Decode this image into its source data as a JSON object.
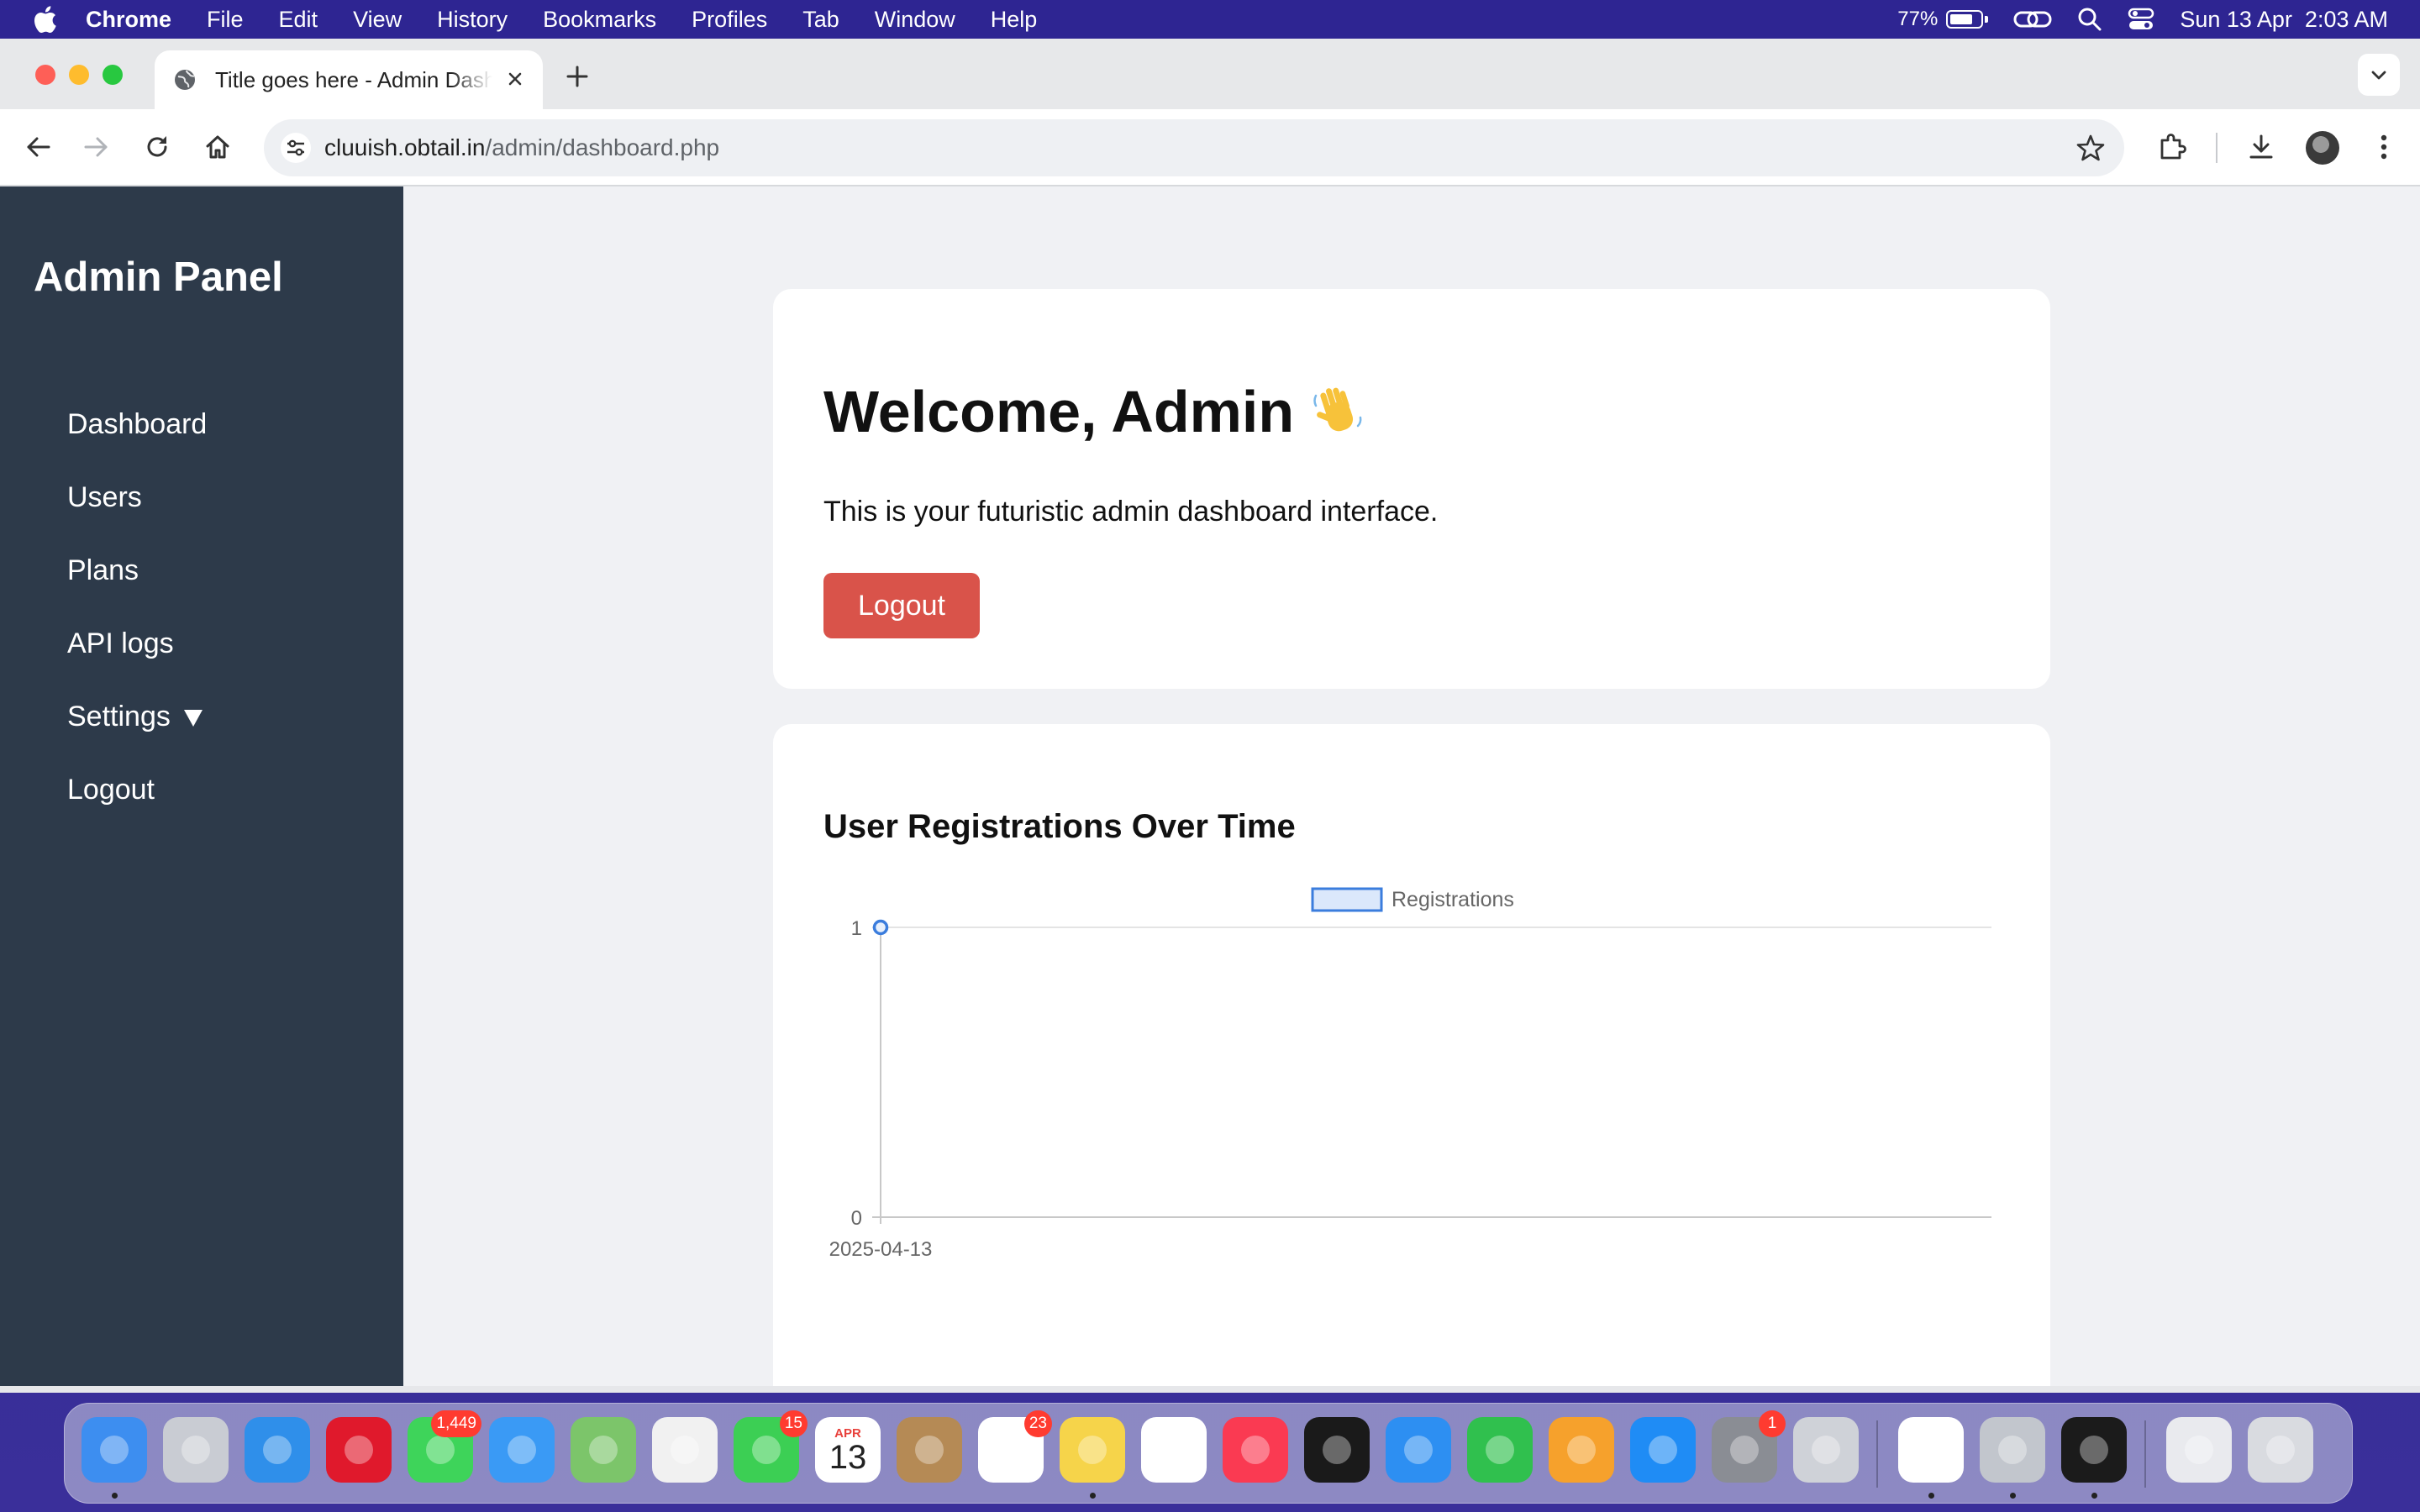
{
  "menubar": {
    "items": [
      "Chrome",
      "File",
      "Edit",
      "View",
      "History",
      "Bookmarks",
      "Profiles",
      "Tab",
      "Window",
      "Help"
    ],
    "battery_percent": "77%",
    "battery_level": 0.77,
    "datetime": "Sun 13 Apr  2:03 AM"
  },
  "browser": {
    "tab_title": "Title goes here - Admin Dashboard",
    "url_host": "cluuish.obtail.in",
    "url_path": "/admin/dashboard.php"
  },
  "sidebar": {
    "brand": "Admin Panel",
    "items": [
      {
        "label": "Dashboard"
      },
      {
        "label": "Users"
      },
      {
        "label": "Plans"
      },
      {
        "label": "API logs"
      },
      {
        "label": "Settings"
      },
      {
        "label": "Logout"
      }
    ]
  },
  "welcome_card": {
    "heading": "Welcome, Admin",
    "subtitle": "This is your futuristic admin dashboard interface.",
    "logout_label": "Logout"
  },
  "chart_card": {
    "title": "User Registrations Over Time"
  },
  "chart_data": {
    "type": "line",
    "title": "User Registrations Over Time",
    "x": [
      "2025-04-13"
    ],
    "series": [
      {
        "name": "Registrations",
        "values": [
          1
        ],
        "color": "#3b7ddd"
      }
    ],
    "ylim": [
      0,
      1
    ],
    "yticks": [
      "1",
      "0"
    ],
    "xlabel": "",
    "ylabel": "",
    "grid": true,
    "legend": "top-center"
  },
  "dock": {
    "apps": [
      {
        "name": "Finder",
        "icon": "finder-icon",
        "color": "#3d8ef0",
        "dot": true
      },
      {
        "name": "Launchpad",
        "icon": "launchpad-icon",
        "color": "#c9ccd3"
      },
      {
        "name": "Safari",
        "icon": "safari-icon",
        "color": "#2f8fea"
      },
      {
        "name": "Opera",
        "icon": "opera-icon",
        "color": "#e0192c"
      },
      {
        "name": "Messages",
        "icon": "messages-icon",
        "color": "#3ed45a",
        "badge": "1,449"
      },
      {
        "name": "Mail",
        "icon": "mail-icon",
        "color": "#3a9af5"
      },
      {
        "name": "Maps",
        "icon": "maps-icon",
        "color": "#7cc56a"
      },
      {
        "name": "Photos",
        "icon": "photos-icon",
        "color": "#f1f1f1"
      },
      {
        "name": "FaceTime",
        "icon": "facetime-icon",
        "color": "#3ccf54",
        "badge": "15"
      },
      {
        "name": "Calendar",
        "icon": "calendar-icon",
        "color": "#ffffff",
        "calendar_month": "APR",
        "calendar_day": "13"
      },
      {
        "name": "Contacts",
        "icon": "contacts-icon",
        "color": "#b58a55"
      },
      {
        "name": "Reminders",
        "icon": "reminders-icon",
        "color": "#ffffff",
        "badge": "23"
      },
      {
        "name": "Notes",
        "icon": "notes-icon",
        "color": "#f6d44a",
        "dot": true
      },
      {
        "name": "Freeform",
        "icon": "freeform-icon",
        "color": "#ffffff"
      },
      {
        "name": "Music",
        "icon": "music-icon",
        "color": "#fa3a52"
      },
      {
        "name": "TV",
        "icon": "tv-icon",
        "color": "#1a1a1a"
      },
      {
        "name": "Keynote",
        "icon": "keynote-icon",
        "color": "#2d8ff2"
      },
      {
        "name": "Numbers",
        "icon": "numbers-icon",
        "color": "#30c04e"
      },
      {
        "name": "Pages",
        "icon": "pages-icon",
        "color": "#f6a12c"
      },
      {
        "name": "App Store",
        "icon": "app-store-icon",
        "color": "#1f8cf5"
      },
      {
        "name": "System Settings",
        "icon": "system-settings-icon",
        "color": "#8a8d94",
        "badge": "1"
      },
      {
        "name": "iPhone Mirroring",
        "icon": "iphone-mirroring-icon",
        "color": "#cfd2d8"
      },
      {
        "name": "Chrome",
        "icon": "chrome-icon",
        "color": "#ffffff",
        "dot": true
      },
      {
        "name": "Preferences",
        "icon": "gear-icon",
        "color": "#c2c6cd",
        "dot": true
      },
      {
        "name": "Terminal",
        "icon": "terminal-icon",
        "color": "#1b1b1b",
        "dot": true
      },
      {
        "name": "Screenshot Preview",
        "icon": "window-thumbnail-icon",
        "color": "#e9eaee"
      },
      {
        "name": "Trash",
        "icon": "trash-icon",
        "color": "#d9dbe0"
      }
    ]
  }
}
